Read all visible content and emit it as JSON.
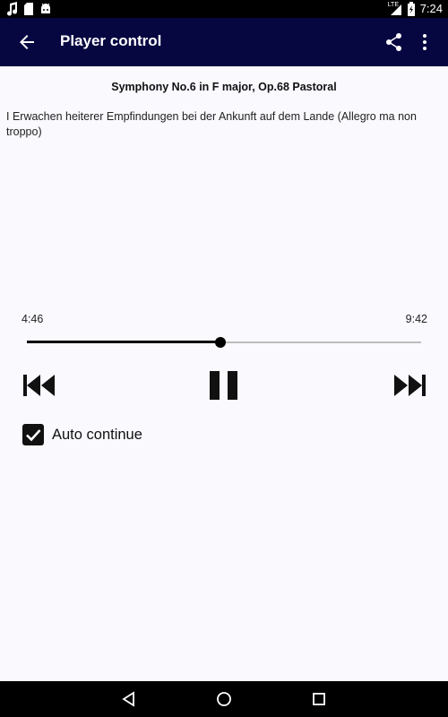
{
  "status_bar": {
    "time": "7:24",
    "network_label": "LTE",
    "left_icons": [
      "music-note-icon",
      "sd-card-icon",
      "android-icon"
    ],
    "right_icons": [
      "signal-icon",
      "battery-icon"
    ]
  },
  "app_bar": {
    "title": "Player control",
    "back_icon": "arrow-back-icon",
    "share_icon": "share-icon",
    "more_icon": "more-vert-icon",
    "background_color": "#060641"
  },
  "track": {
    "title": "Symphony No.6 in F major, Op.68 Pastoral",
    "movement": "I Erwachen heiterer Empfindungen bei der Ankunft auf dem Lande (Allegro ma non troppo)"
  },
  "playback": {
    "elapsed": "4:46",
    "total": "9:42",
    "progress": 0.491
  },
  "controls": {
    "previous_icon": "skip-previous-icon",
    "pause_icon": "pause-icon",
    "next_icon": "skip-next-icon"
  },
  "auto_continue": {
    "label": "Auto continue",
    "checked": true
  },
  "nav_bar": {
    "icons": [
      "back-triangle-icon",
      "home-circle-icon",
      "recents-square-icon"
    ]
  }
}
